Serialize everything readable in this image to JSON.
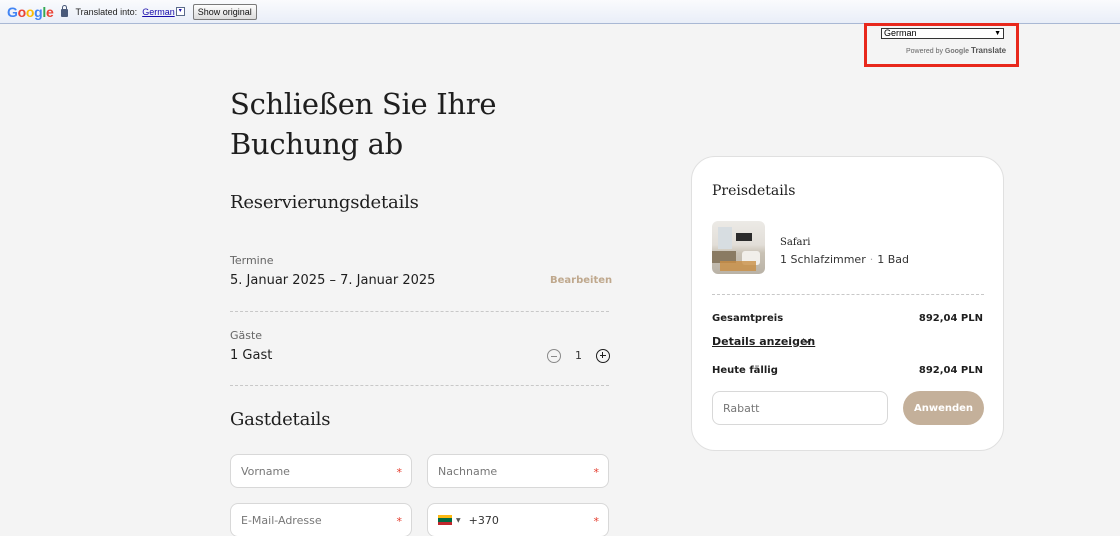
{
  "translate_bar": {
    "logo": "Google",
    "translated_into_label": "Translated into:",
    "language_link": "German",
    "dropdown_glyph": "▾",
    "show_original_label": "Show original"
  },
  "translate_widget": {
    "selected_language": "German",
    "powered_by_label": "Powered by",
    "google_label": "Google",
    "translate_label": "Translate",
    "highlight_color": "#e8281c"
  },
  "page": {
    "title": "Schließen Sie Ihre Buchung ab"
  },
  "reservation": {
    "heading": "Reservierungsdetails",
    "dates_label": "Termine",
    "dates_value": "5. Januar 2025 – 7. Januar 2025",
    "edit_label": "Bearbeiten",
    "guests_label": "Gäste",
    "guests_value": "1 Gast",
    "guest_count": "1"
  },
  "guest_details": {
    "heading": "Gastdetails",
    "first_name_placeholder": "Vorname",
    "last_name_placeholder": "Nachname",
    "email_placeholder": "E-Mail-Adresse",
    "phone_prefix": "+370",
    "required_mark": "*",
    "flag_icon": "lithuania-flag-icon"
  },
  "price_card": {
    "title": "Preisdetails",
    "property_name": "Safari",
    "bedrooms": "1 Schlafzimmer",
    "separator": "·",
    "bathrooms": "1 Bad",
    "total_label": "Gesamtpreis",
    "total_value": "892,04 PLN",
    "details_link": "Details anzeigen",
    "due_today_label": "Heute fällig",
    "due_today_value": "892,04 PLN",
    "discount_placeholder": "Rabatt",
    "apply_label": "Anwenden",
    "accent_color": "#c4b09a"
  }
}
